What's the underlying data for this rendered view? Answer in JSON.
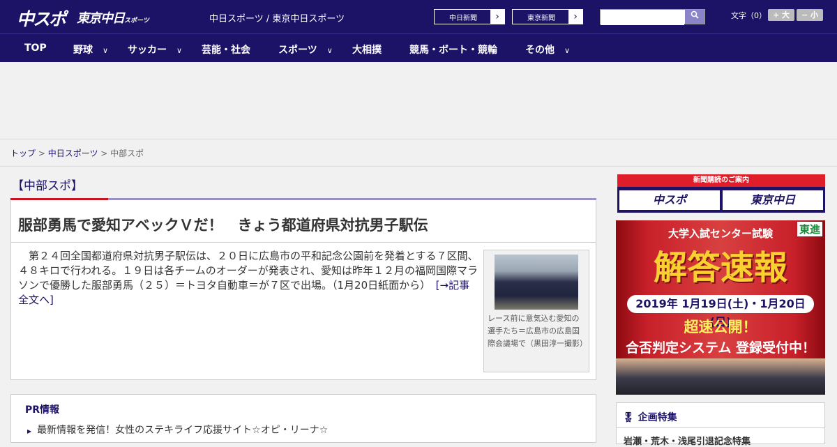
{
  "header": {
    "logo_chuspo": "中スポ",
    "logo_tokyo": "東京中日",
    "logo_tokyo_small": "スポーツ",
    "site_name": "中日スポーツ / 東京中日スポーツ",
    "ext_links": [
      "中日新聞",
      "東京新聞"
    ],
    "search_placeholder": "",
    "font_size_label": "文字（0）",
    "font_bigger": "+ 大",
    "font_smaller": "− 小"
  },
  "nav": {
    "items": [
      {
        "label": "TOP",
        "dropdown": false
      },
      {
        "label": "野球",
        "dropdown": true
      },
      {
        "label": "サッカー",
        "dropdown": true
      },
      {
        "label": "芸能・社会",
        "dropdown": false
      },
      {
        "label": "スポーツ",
        "dropdown": true
      },
      {
        "label": "大相撲",
        "dropdown": false
      },
      {
        "label": "競馬・ボート・競輪",
        "dropdown": false
      },
      {
        "label": "その他",
        "dropdown": true
      }
    ]
  },
  "breadcrumb": {
    "home": "トップ",
    "sep": " > ",
    "level1": "中日スポーツ",
    "current": "中部スポ"
  },
  "section": {
    "title": "【中部スポ】"
  },
  "article": {
    "headline": "服部勇馬で愛知アベックＶだ！　きょう都道府県対抗男子駅伝",
    "body": "　第２４回全国都道府県対抗男子駅伝は、２０日に広島市の平和記念公園前を発着とする７区間、４８キロで行われる。１９日は各チームのオーダーが発表され、愛知は昨年１２月の福岡国際マラソンで優勝した服部勇馬（２５）＝トヨタ自動車＝が７区で出場。（1月20日紙面から）",
    "more_link": "[→記事全文へ]",
    "photo_caption": "レース前に意気込む愛知の選手たち＝広島市の広島国際会議場で（黒田淳一撮影）"
  },
  "pr": {
    "title": "PR情報",
    "items": [
      "最新情報を発信！女性のステキライフ応援サイト☆オピ・リーナ☆"
    ]
  },
  "sidebar": {
    "subscribe_title": "新聞購読のご案内",
    "subscribe_buttons": [
      "中スポ",
      "東京中日"
    ],
    "banner": {
      "top": "大学入試センター試験",
      "brand": "東進",
      "main": "解答速報",
      "dates": "2019年 1月19日(土)・1月20日(日)",
      "release": "超速公開！",
      "system": "合否判定システム 登録受付中！"
    },
    "feature_title": "企画特集",
    "feature_item": "岩瀬・荒木・浅尾引退記念特集"
  },
  "colors": {
    "navy": "#1c1266",
    "red": "#c8141e",
    "accent": "#9a90c8"
  }
}
